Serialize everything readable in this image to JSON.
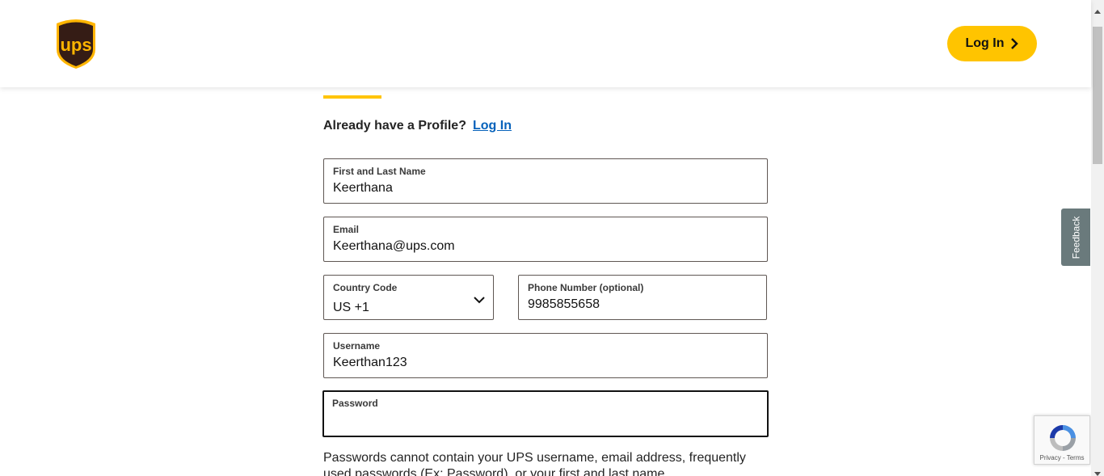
{
  "header": {
    "logo_text": "ups",
    "login_button": "Log In"
  },
  "form": {
    "already_text": "Already have a Profile?",
    "already_link": "Log In",
    "fields": {
      "name": {
        "label": "First and Last Name",
        "value": "Keerthana"
      },
      "email": {
        "label": "Email",
        "value": "Keerthana@ups.com"
      },
      "country": {
        "label": "Country Code",
        "value": "US +1"
      },
      "phone": {
        "label": "Phone Number (optional)",
        "value": "9985855658"
      },
      "username": {
        "label": "Username",
        "value": "Keerthan123"
      },
      "password": {
        "label": "Password",
        "value": ""
      }
    },
    "password_note": "Passwords cannot contain your UPS username, email address, frequently used passwords (Ex: Password), or your first and last name."
  },
  "feedback_tab": "Feedback",
  "recaptcha": {
    "links": "Privacy - Terms"
  },
  "colors": {
    "brand_gold": "#ffc400",
    "brand_brown": "#351c15",
    "link_blue": "#0662bb"
  },
  "icons": [
    "ups-logo-icon",
    "chevron-right-icon",
    "chevron-down-icon",
    "recaptcha-icon"
  ]
}
